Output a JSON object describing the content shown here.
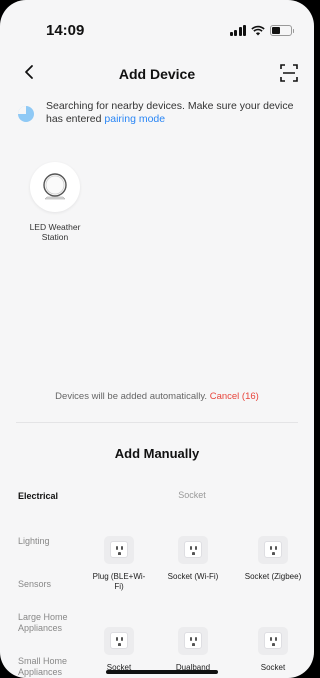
{
  "status_bar": {
    "time": "14:09"
  },
  "header": {
    "title": "Add Device"
  },
  "search": {
    "message": "Searching for nearby devices. Make sure your device has entered",
    "link": "pairing mode"
  },
  "found_devices": [
    {
      "name": "LED Weather Station",
      "icon": "weather-station-icon"
    }
  ],
  "auto_add": {
    "message": "Devices will be added automatically.",
    "cancel": "Cancel (16)"
  },
  "manual": {
    "title": "Add Manually",
    "categories": [
      {
        "label": "Electrical",
        "active": true
      },
      {
        "label": "Lighting",
        "active": false
      },
      {
        "label": "Sensors",
        "active": false
      },
      {
        "label": "Large Home Appliances",
        "active": false
      },
      {
        "label": "Small Home Appliances",
        "active": false
      }
    ],
    "section": "Socket",
    "items": [
      {
        "label": "Plug (BLE+Wi-Fi)"
      },
      {
        "label": "Socket (Wi-Fi)"
      },
      {
        "label": "Socket (Zigbee)"
      },
      {
        "label": "Socket"
      },
      {
        "label": "Dualband"
      },
      {
        "label": "Socket"
      }
    ]
  },
  "colors": {
    "accent": "#2a86f5",
    "cancel": "#e8453c",
    "background": "#f6f6f7"
  }
}
